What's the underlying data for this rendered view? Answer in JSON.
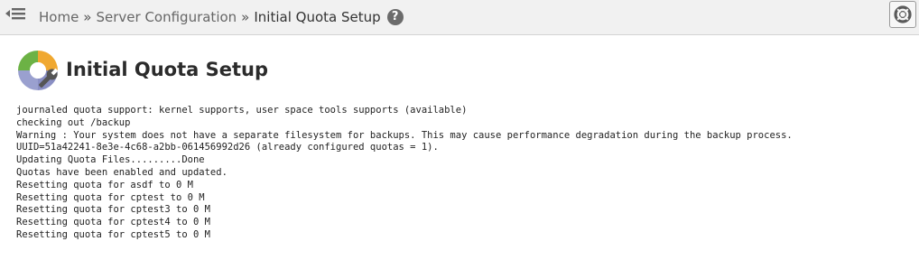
{
  "topbar": {
    "collapse_icon": "collapse-menu-icon",
    "breadcrumb": {
      "home": "Home",
      "separator": "»",
      "section": "Server Configuration",
      "current": "Initial Quota Setup"
    },
    "help_icon": "question-circle-icon",
    "help_glyph": "?",
    "support_icon": "lifebuoy-icon"
  },
  "page": {
    "title": "Initial Quota Setup",
    "logo_icon": "quota-wrench-icon"
  },
  "output_lines": [
    "journaled quota support: kernel supports, user space tools supports (available)",
    "checking out /backup",
    "Warning : Your system does not have a separate filesystem for backups. This may cause performance degradation during the backup process.",
    "UUID=51a42241-8e3e-4c68-a2bb-061456992d26 (already configured quotas = 1).",
    "Updating Quota Files.........Done",
    "Quotas have been enabled and updated.",
    "Resetting quota for asdf to 0 M",
    "Resetting quota for cptest to 0 M",
    "Resetting quota for cptest3 to 0 M",
    "Resetting quota for cptest4 to 0 M",
    "Resetting quota for cptest5 to 0 M"
  ]
}
